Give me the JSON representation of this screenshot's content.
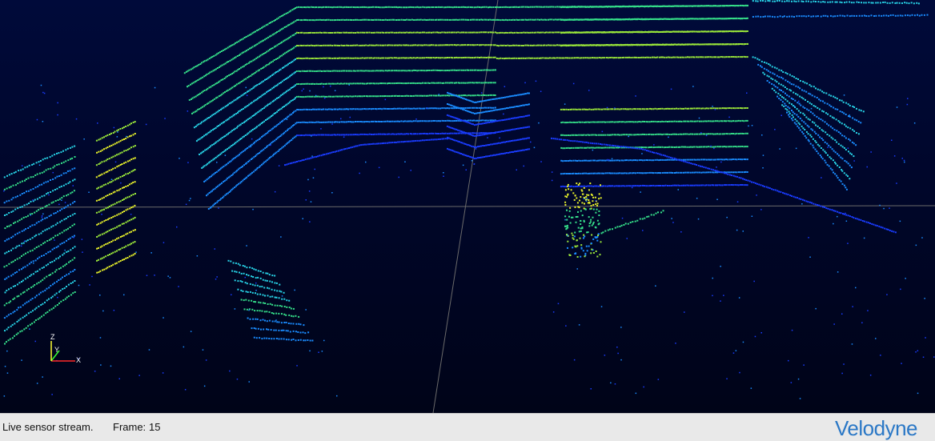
{
  "viewer": {
    "status_text": "Live sensor stream.",
    "frame_label": "Frame:",
    "frame_number": "15",
    "brand": "Velodyne",
    "axes": {
      "z": "Z",
      "y": "Y",
      "x": "X"
    }
  },
  "colors": {
    "background": "#000a3a",
    "grid_line": "#6a6a6a",
    "colormap": [
      "#1a3cff",
      "#1a8cff",
      "#27d3e6",
      "#35e08a",
      "#9be83a",
      "#e6f02a"
    ],
    "status_bar": "#e9e9e9",
    "brand": "#2b78c6"
  }
}
